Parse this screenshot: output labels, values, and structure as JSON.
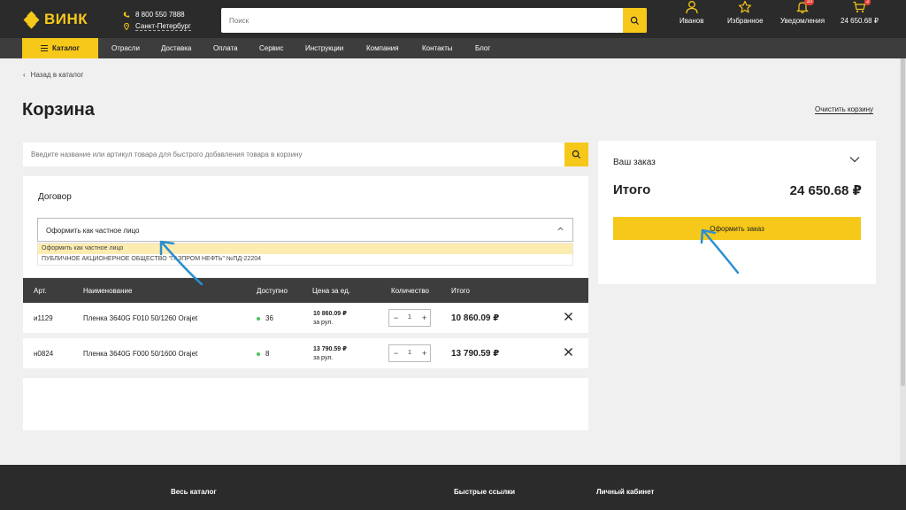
{
  "header": {
    "logo": "ВИНК",
    "phone": "8 800 550 7888",
    "city": "Санкт-Петербург",
    "search_placeholder": "Поиск",
    "user": "Иванов",
    "favorites": "Избранное",
    "notifications": "Уведомления",
    "notifications_count": "10",
    "cart_total": "24 650.68 ₽",
    "cart_count": "2"
  },
  "nav": {
    "catalog": "Каталог",
    "links": [
      "Отрасли",
      "Доставка",
      "Оплата",
      "Сервис",
      "Инструкции",
      "Компания",
      "Контакты",
      "Блог"
    ]
  },
  "page": {
    "back": "Назад в каталог",
    "title": "Корзина",
    "clear": "Очистить корзину",
    "quick_add_placeholder": "Введите название или артикул товара для быстрого добавления товара в корзину"
  },
  "contract": {
    "label": "Договор",
    "selected": "Оформить как частное лицо",
    "options": [
      "Оформить как частное лицо",
      "ПУБЛИЧНОЕ АКЦИОНЕРНОЕ ОБЩЕСТВО \"ГАЗПРОМ НЕФТЬ\" №ПД-22204"
    ]
  },
  "table": {
    "headers": {
      "art": "Арт.",
      "name": "Наименование",
      "avail": "Доступно",
      "price": "Цена за ед.",
      "qty": "Количество",
      "total": "Итого"
    },
    "rows": [
      {
        "art": "и1129",
        "name": "Пленка 3640G F010 50/1260 Orajet",
        "avail": "36",
        "price": "10 860.09 ₽",
        "unit": "за рул.",
        "qty": "1",
        "total": "10 860.09 ₽"
      },
      {
        "art": "н0824",
        "name": "Пленка 3640G F000 50/1600 Orajet",
        "avail": "8",
        "price": "13 790.59 ₽",
        "unit": "за рул.",
        "qty": "1",
        "total": "13 790.59 ₽"
      }
    ]
  },
  "order": {
    "title": "Ваш заказ",
    "total_label": "Итого",
    "total_value": "24 650.68 ₽",
    "checkout": "Оформить заказ"
  },
  "footer": {
    "col1": "Весь каталог",
    "col2": "Быстрые ссылки",
    "col3": "Личный кабинет"
  },
  "colors": {
    "accent": "#f6c81a",
    "dark": "#2b2b2b",
    "arrow": "#2a8fd0",
    "in_stock": "#4cc35b"
  }
}
